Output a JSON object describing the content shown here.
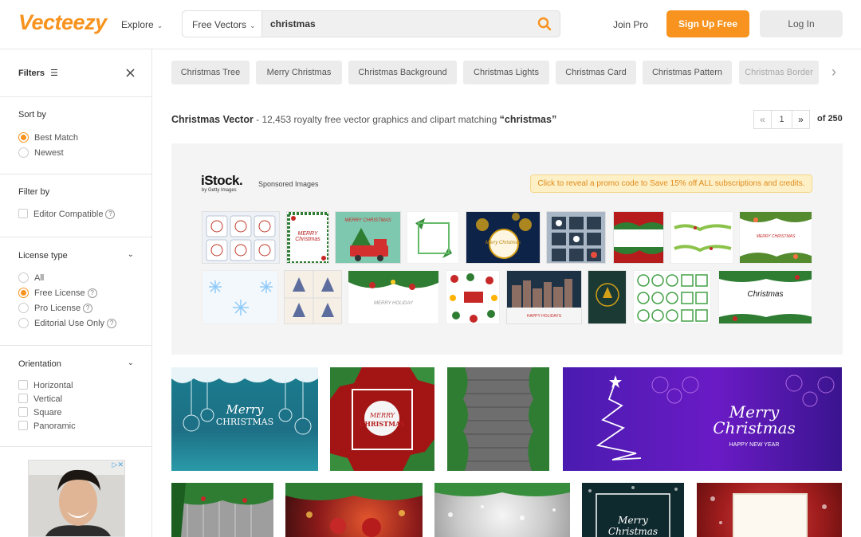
{
  "header": {
    "logo": "Vecteezy",
    "explore": "Explore",
    "search_type": "Free Vectors",
    "search_value": "christmas",
    "join_pro": "Join Pro",
    "sign_up": "Sign Up Free",
    "log_in": "Log In"
  },
  "sidebar": {
    "filters_title": "Filters",
    "sort_by": {
      "title": "Sort by",
      "options": [
        "Best Match",
        "Newest"
      ],
      "selected": "Best Match"
    },
    "filter_by": {
      "title": "Filter by",
      "options": [
        "Editor Compatible"
      ]
    },
    "license_type": {
      "title": "License type",
      "options": [
        "All",
        "Free License",
        "Pro License",
        "Editorial Use Only"
      ],
      "selected": "Free License"
    },
    "orientation": {
      "title": "Orientation",
      "options": [
        "Horizontal",
        "Vertical",
        "Square",
        "Panoramic"
      ]
    }
  },
  "tags": [
    "Christmas Tree",
    "Merry Christmas",
    "Christmas Background",
    "Christmas Lights",
    "Christmas Card",
    "Christmas Pattern",
    "Christmas Border"
  ],
  "results": {
    "title": "Christmas Vector",
    "summary": " - 12,453 royalty free vector graphics and clipart matching ",
    "query": "“christmas”",
    "page": "1",
    "of": "of 250"
  },
  "sponsored": {
    "brand": "iStock.",
    "brand_sub": "by Getty Images",
    "label": "Sponsored Images",
    "promo": "Click to reveal a promo code to Save 15% off ALL subscriptions and credits."
  },
  "tiles": {
    "t1_line1": "Merry",
    "t1_line2": "CHRISTMAS",
    "t2_line1": "MERRY",
    "t2_line2": "CHRISTMAS",
    "t4_line1": "Merry",
    "t4_line2": "Christmas",
    "t4_line3": "HAPPY NEW YEAR",
    "b4_line1": "Merry",
    "b4_line2": "Christmas"
  },
  "sp_thumbs": {
    "s2_text": "MERRY Christmas",
    "s3_text": "MERRY CHRISTMAS",
    "s5_text": "Merry Christmas",
    "s9_text": "MERRY CHRISTMAS",
    "s12_text": "MERRY HOLIDAY",
    "s14_text": "HAPPY HOLIDAYS",
    "s17_text": "Christmas"
  },
  "colors": {
    "brand_orange": "#f7931e",
    "promo_bg": "#fdf0c7"
  }
}
